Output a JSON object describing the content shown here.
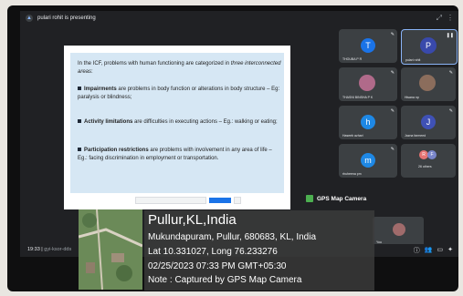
{
  "meeting": {
    "presenter_text": "pulari rohit is presenting",
    "clock": "19:33",
    "meeting_code": "gyi-ksor-dds"
  },
  "slide": {
    "para1_prefix": "In the ICF, problems with human functioning are categorized in ",
    "para1_emph": "three interconnected areas",
    "para1_suffix": ":",
    "impairments_term": "Impairments",
    "impairments_text": " are problems in body function or alterations in body structure – Eg: paralysis or blindness;",
    "activity_term": "Activity limitations",
    "activity_text": " are difficulties in executing actions – Eg.: walking or eating;",
    "participation_term": "Participation restrictions",
    "participation_text": " are problems with involvement in any area of life – Eg.: facing discrimination in employment or transportation."
  },
  "tiles": [
    {
      "name": "THOUBA P R",
      "initial": "T",
      "color": "#1a73e8"
    },
    {
      "name": "pulari rohit",
      "initial": "P",
      "color": "#3949ab"
    },
    {
      "name": "THASNI BINSHA P K",
      "initial": "",
      "color": "#b06a8a"
    },
    {
      "name": "Hisana np",
      "initial": "",
      "color": "#8b6d5c"
    },
    {
      "name": "Haseeb azhari",
      "initial": "h",
      "color": "#1e88e5"
    },
    {
      "name": "Jazna farmeed",
      "initial": "J",
      "color": "#3f51b5"
    },
    {
      "name": "rhuheena pm",
      "initial": "m",
      "color": "#1e88e5"
    },
    {
      "name": "26 others",
      "initial": "",
      "color": ""
    }
  ],
  "self_tile": {
    "name": "You"
  },
  "gps": {
    "app_title": "GPS Map Camera",
    "city": "Pullur,KL,India",
    "address": "Mukundapuram, Pullur, 680683, KL, India",
    "coords": "Lat 10.331027, Long 76.233276",
    "datetime": "02/25/2023 07:33 PM GMT+05:30",
    "note": "Note : Captured by GPS Map Camera"
  },
  "colors": {
    "meet_bg": "#202124",
    "tile_bg": "#3c4043",
    "slide_bg": "#d6e7f4",
    "active_border": "#8ab4f8",
    "gps_panel": "#3c3c3c"
  }
}
